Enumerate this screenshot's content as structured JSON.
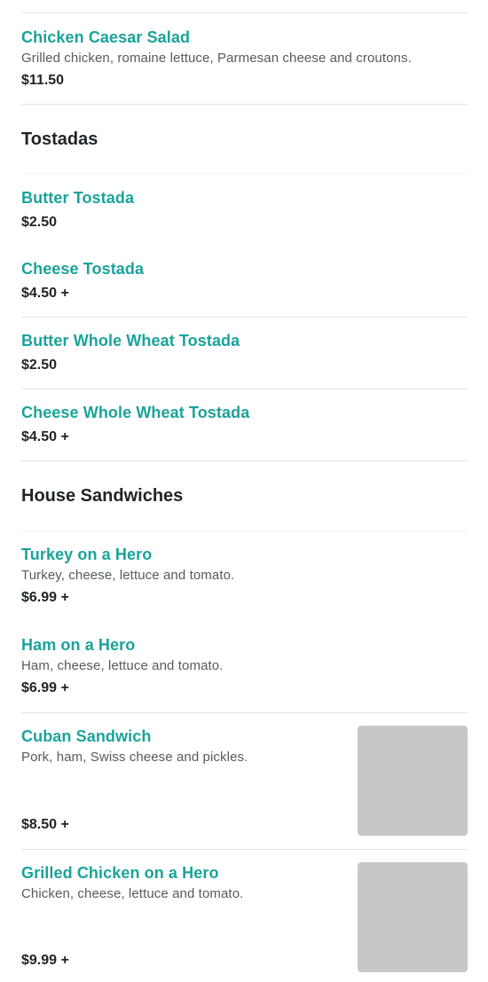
{
  "top_item": {
    "name": "Chicken Caesar Salad",
    "description": "Grilled chicken, romaine lettuce, Parmesan cheese and croutons.",
    "price": "$11.50"
  },
  "sections": [
    {
      "title": "Tostadas",
      "items": [
        {
          "name": "Butter Tostada",
          "price": "$2.50"
        },
        {
          "name": "Cheese Tostada",
          "price": "$4.50 +"
        },
        {
          "name": "Butter Whole Wheat Tostada",
          "price": "$2.50"
        },
        {
          "name": "Cheese Whole Wheat Tostada",
          "price": "$4.50 +"
        }
      ]
    },
    {
      "title": "House Sandwiches",
      "items": [
        {
          "name": "Turkey on a Hero",
          "description": "Turkey, cheese, lettuce and tomato.",
          "price": "$6.99 +"
        },
        {
          "name": "Ham on a Hero",
          "description": "Ham, cheese, lettuce and tomato.",
          "price": "$6.99 +"
        },
        {
          "name": "Cuban Sandwich",
          "description": "Pork, ham, Swiss cheese and pickles.",
          "price": "$8.50 +"
        },
        {
          "name": "Grilled Chicken on a Hero",
          "description": "Chicken, cheese, lettuce and tomato.",
          "price": "$9.99 +"
        }
      ]
    }
  ],
  "colors": {
    "item_name": "#1aa39a",
    "price": "#1f2428",
    "description": "#555b61",
    "image_placeholder": "#c7c7c9"
  }
}
